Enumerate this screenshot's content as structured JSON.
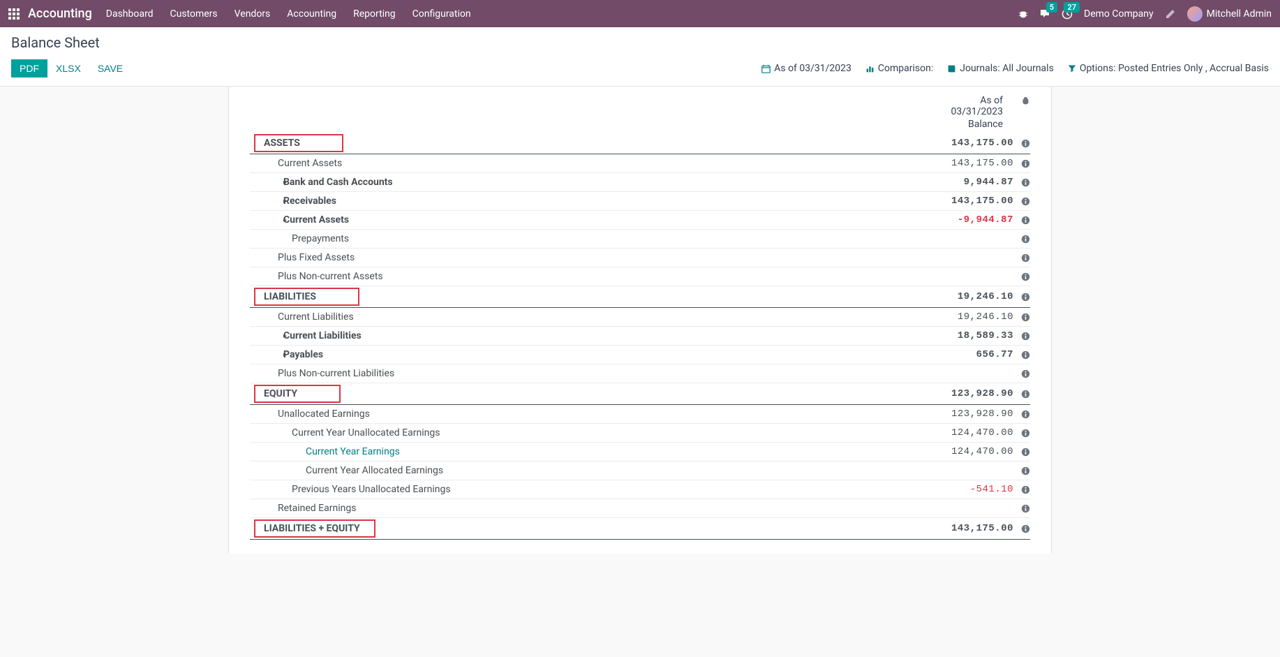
{
  "nav": {
    "brand": "Accounting",
    "menu": [
      "Dashboard",
      "Customers",
      "Vendors",
      "Accounting",
      "Reporting",
      "Configuration"
    ],
    "messages_badge": "5",
    "activity_badge": "27",
    "company": "Demo Company",
    "user": "Mitchell Admin"
  },
  "page": {
    "title": "Balance Sheet",
    "btn_pdf": "PDF",
    "btn_xlsx": "XLSX",
    "btn_save": "SAVE",
    "asof": "As of 03/31/2023",
    "comparison": "Comparison:",
    "journals": "Journals: All Journals",
    "options": "Options: Posted Entries Only , Accrual Basis"
  },
  "report": {
    "header_asof1": "As of",
    "header_asof2": "03/31/2023",
    "header_balance": "Balance",
    "rows": [
      {
        "label": "ASSETS",
        "value": "143,175.00",
        "section": true,
        "highlight": true,
        "indent": 0
      },
      {
        "label": "Current Assets",
        "value": "143,175.00",
        "indent": 1
      },
      {
        "label": "Bank and Cash Accounts",
        "value": "9,944.87",
        "bold": true,
        "caret": true,
        "indent": 2
      },
      {
        "label": "Receivables",
        "value": "143,175.00",
        "bold": true,
        "caret": true,
        "indent": 2
      },
      {
        "label": "Current Assets",
        "value": "-9,944.87",
        "bold": true,
        "caret": true,
        "neg": true,
        "indent": 2
      },
      {
        "label": "Prepayments",
        "value": "",
        "indent": 2
      },
      {
        "label": "Plus Fixed Assets",
        "value": "",
        "indent": 1
      },
      {
        "label": "Plus Non-current Assets",
        "value": "",
        "indent": 1
      },
      {
        "label": "LIABILITIES",
        "value": "19,246.10",
        "section": true,
        "highlight": true,
        "indent": 0
      },
      {
        "label": "Current Liabilities",
        "value": "19,246.10",
        "indent": 1
      },
      {
        "label": "Current Liabilities",
        "value": "18,589.33",
        "bold": true,
        "caret": true,
        "indent": 2
      },
      {
        "label": "Payables",
        "value": "656.77",
        "bold": true,
        "caret": true,
        "indent": 2
      },
      {
        "label": "Plus Non-current Liabilities",
        "value": "",
        "indent": 1
      },
      {
        "label": "EQUITY",
        "value": "123,928.90",
        "section": true,
        "highlight": true,
        "indent": 0
      },
      {
        "label": "Unallocated Earnings",
        "value": "123,928.90",
        "indent": 1
      },
      {
        "label": "Current Year Unallocated Earnings",
        "value": "124,470.00",
        "indent": 2
      },
      {
        "label": "Current Year Earnings",
        "value": "124,470.00",
        "link": true,
        "indent": 3
      },
      {
        "label": "Current Year Allocated Earnings",
        "value": "",
        "indent": 3
      },
      {
        "label": "Previous Years Unallocated Earnings",
        "value": "-541.10",
        "neg": true,
        "indent": 2
      },
      {
        "label": "Retained Earnings",
        "value": "",
        "indent": 1
      },
      {
        "label": "LIABILITIES + EQUITY",
        "value": "143,175.00",
        "section": true,
        "highlight": true,
        "highlight_wide": true,
        "indent": 0
      }
    ]
  }
}
